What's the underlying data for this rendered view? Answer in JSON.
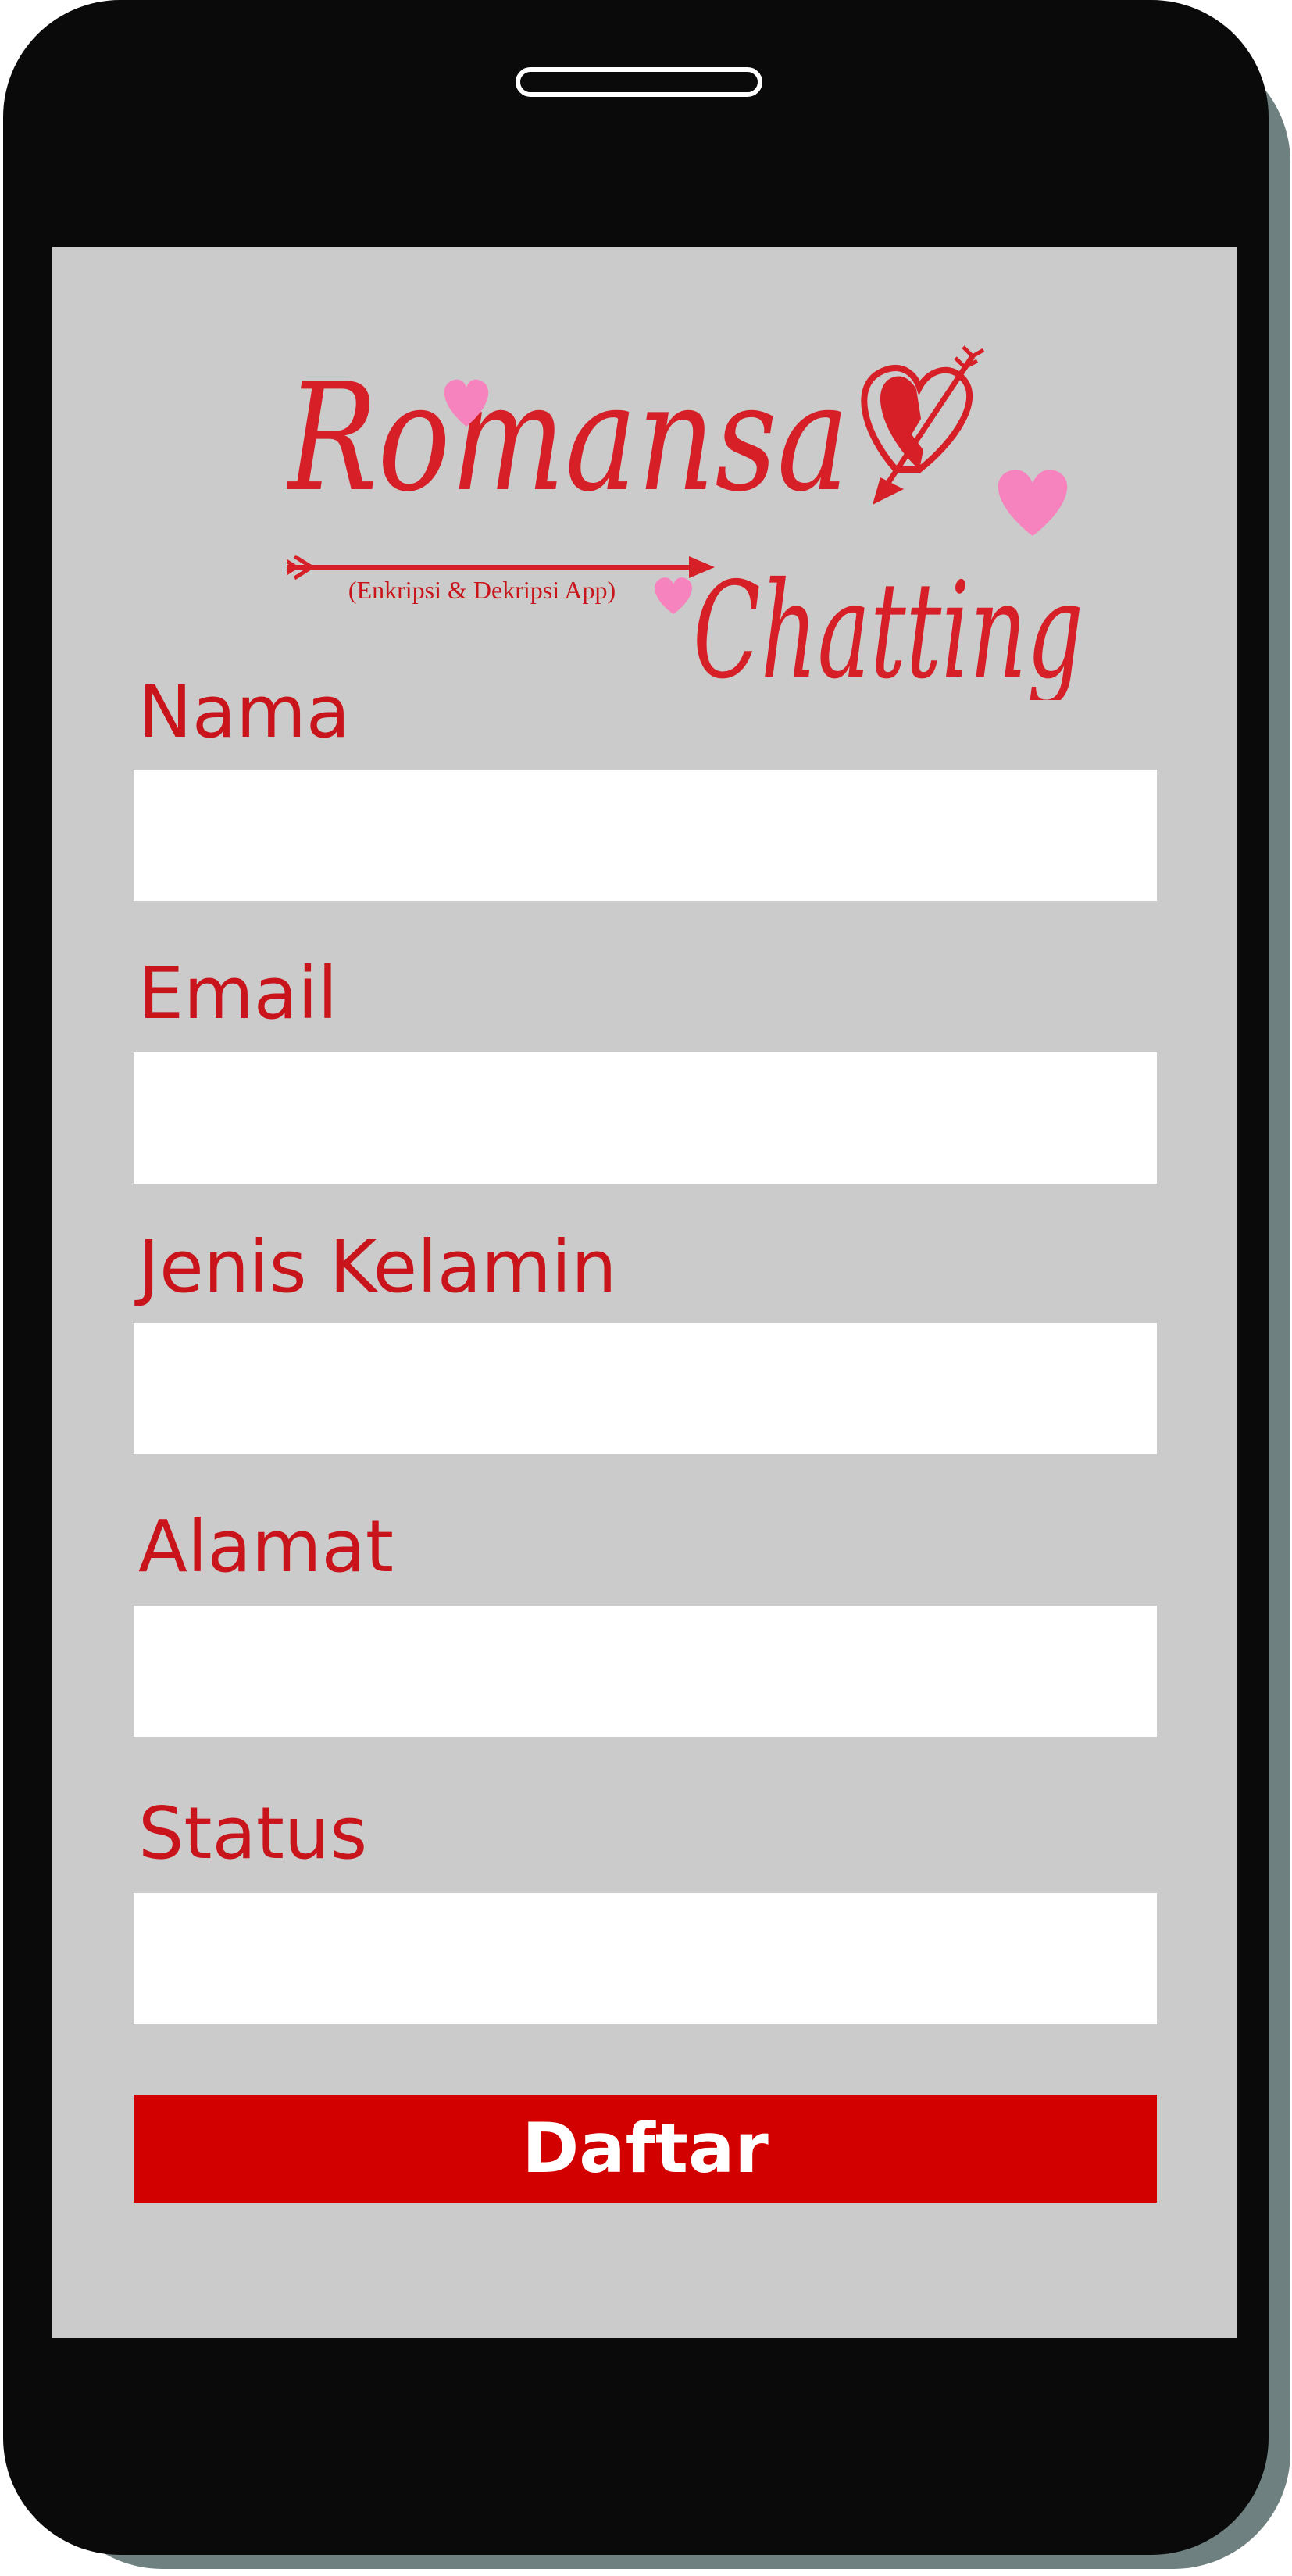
{
  "app": {
    "name_line1": "Romansa",
    "name_line2": "Chatting",
    "subtitle": "(Enkripsi & Dekripsi App)"
  },
  "form": {
    "fields": [
      {
        "label": "Nama",
        "value": "",
        "placeholder": ""
      },
      {
        "label": "Email",
        "value": "",
        "placeholder": ""
      },
      {
        "label": "Jenis Kelamin",
        "value": "",
        "placeholder": ""
      },
      {
        "label": "Alamat",
        "value": "",
        "placeholder": ""
      },
      {
        "label": "Status",
        "value": "",
        "placeholder": ""
      }
    ],
    "submit_label": "Daftar"
  },
  "icons": [
    "heart-icon",
    "arrow-icon",
    "broken-heart-arrow-icon"
  ],
  "colors": {
    "accent": "#d30000",
    "label": "#c8141a",
    "screen": "#cbcbcb",
    "phone": "#0a0a0a",
    "shadow": "#6e8180",
    "heart_pink": "#f683bd"
  }
}
